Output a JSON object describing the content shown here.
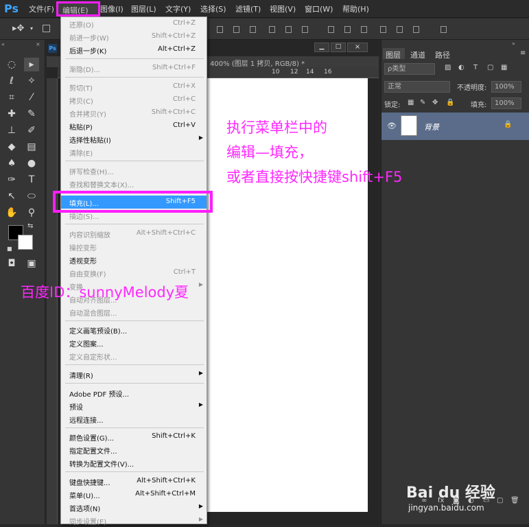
{
  "app": {
    "logo": "Ps"
  },
  "menubar": {
    "items": [
      "文件(F)",
      "编辑(E)",
      "图像(I)",
      "图层(L)",
      "文字(Y)",
      "选择(S)",
      "滤镜(T)",
      "视图(V)",
      "窗口(W)",
      "帮助(H)"
    ]
  },
  "document": {
    "tab_title": "400% (图层 1 拷贝, RGB/8) *",
    "ruler_marks": [
      "10",
      "12",
      "14",
      "16"
    ],
    "ps_badge": "Ps"
  },
  "edit_menu": {
    "items": [
      {
        "label": "还原(O)",
        "shortcut": "Ctrl+Z",
        "enabled": false
      },
      {
        "label": "前进一步(W)",
        "shortcut": "Shift+Ctrl+Z",
        "enabled": false
      },
      {
        "label": "后退一步(K)",
        "shortcut": "Alt+Ctrl+Z",
        "enabled": true
      },
      {
        "label": "渐隐(D)...",
        "shortcut": "Shift+Ctrl+F",
        "enabled": false
      },
      {
        "label": "剪切(T)",
        "shortcut": "Ctrl+X",
        "enabled": false
      },
      {
        "label": "拷贝(C)",
        "shortcut": "Ctrl+C",
        "enabled": false
      },
      {
        "label": "合并拷贝(Y)",
        "shortcut": "Shift+Ctrl+C",
        "enabled": false
      },
      {
        "label": "粘贴(P)",
        "shortcut": "Ctrl+V",
        "enabled": true
      },
      {
        "label": "选择性粘贴(I)",
        "shortcut": "",
        "enabled": true,
        "submenu": true
      },
      {
        "label": "清除(E)",
        "shortcut": "",
        "enabled": false
      },
      {
        "label": "拼写检查(H)...",
        "shortcut": "",
        "enabled": false
      },
      {
        "label": "查找和替换文本(X)...",
        "shortcut": "",
        "enabled": false
      },
      {
        "label": "填充(L)...",
        "shortcut": "Shift+F5",
        "enabled": true,
        "highlighted": true
      },
      {
        "label": "描边(S)...",
        "shortcut": "",
        "enabled": false
      },
      {
        "label": "内容识别缩放",
        "shortcut": "Alt+Shift+Ctrl+C",
        "enabled": false
      },
      {
        "label": "操控变形",
        "shortcut": "",
        "enabled": false
      },
      {
        "label": "透视变形",
        "shortcut": "",
        "enabled": true
      },
      {
        "label": "自由变换(F)",
        "shortcut": "Ctrl+T",
        "enabled": false
      },
      {
        "label": "变换",
        "shortcut": "",
        "enabled": false,
        "submenu": true
      },
      {
        "label": "自动对齐图层...",
        "shortcut": "",
        "enabled": false
      },
      {
        "label": "自动混合图层...",
        "shortcut": "",
        "enabled": false
      },
      {
        "label": "定义画笔预设(B)...",
        "shortcut": "",
        "enabled": true
      },
      {
        "label": "定义图案...",
        "shortcut": "",
        "enabled": true
      },
      {
        "label": "定义自定形状...",
        "shortcut": "",
        "enabled": false
      },
      {
        "label": "清理(R)",
        "shortcut": "",
        "enabled": true,
        "submenu": true
      },
      {
        "label": "Adobe PDF 预设...",
        "shortcut": "",
        "enabled": true
      },
      {
        "label": "预设",
        "shortcut": "",
        "enabled": true,
        "submenu": true
      },
      {
        "label": "远程连接...",
        "shortcut": "",
        "enabled": true
      },
      {
        "label": "颜色设置(G)...",
        "shortcut": "Shift+Ctrl+K",
        "enabled": true
      },
      {
        "label": "指定配置文件...",
        "shortcut": "",
        "enabled": true
      },
      {
        "label": "转换为配置文件(V)...",
        "shortcut": "",
        "enabled": true
      },
      {
        "label": "键盘快捷键...",
        "shortcut": "Alt+Shift+Ctrl+K",
        "enabled": true
      },
      {
        "label": "菜单(U)...",
        "shortcut": "Alt+Shift+Ctrl+M",
        "enabled": true
      },
      {
        "label": "首选项(N)",
        "shortcut": "",
        "enabled": true,
        "submenu": true
      },
      {
        "label": "同步设置(E)",
        "shortcut": "",
        "enabled": false,
        "submenu": true
      }
    ]
  },
  "layers_panel": {
    "tabs": [
      "图层",
      "通道",
      "路径"
    ],
    "kind_filter": "ρ类型",
    "blend_mode": "正常",
    "opacity_label": "不透明度:",
    "opacity_value": "100%",
    "lock_label": "锁定:",
    "fill_label": "填充:",
    "fill_value": "100%",
    "layer_name": "背景"
  },
  "annotations": {
    "instruction_line1": "执行菜单栏中的",
    "instruction_line2": "编辑—填充，",
    "instruction_line3": "或者直接按快捷键shift+F5",
    "author": "百度ID：sunnyMelody夏"
  },
  "watermark": {
    "brand": "Bai du 经验",
    "url": "jingyan.baidu.com"
  },
  "colors": {
    "highlight": "#3399ff",
    "annotation": "#ff28ff"
  }
}
